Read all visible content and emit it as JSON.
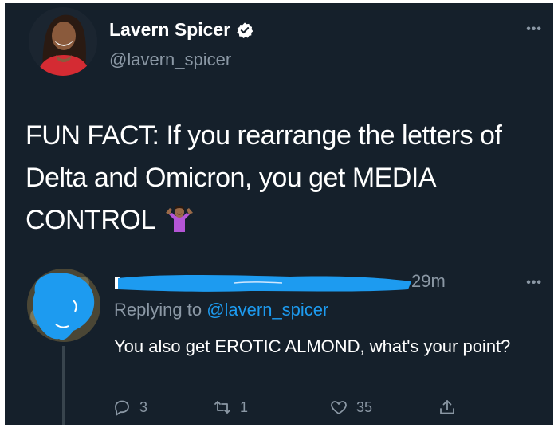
{
  "tweet": {
    "author_name": "Lavern Spicer",
    "author_handle": "@lavern_spicer",
    "text": "FUN FACT: If you rearrange the letters of Delta and Omicron, you get MEDIA CONTROL"
  },
  "reply": {
    "time": "29m",
    "replying_prefix": "Replying to ",
    "replying_to": "@lavern_spicer",
    "text": "You also get EROTIC ALMOND, what's your point?",
    "counts": {
      "replies": "3",
      "retweets": "1",
      "likes": "35"
    }
  },
  "icons": {
    "verified": "verified-badge-icon",
    "more": "more-horizontal-icon",
    "emoji": "person-shrugging-emoji",
    "reply": "reply-icon",
    "retweet": "retweet-icon",
    "like": "heart-icon",
    "share": "share-icon"
  },
  "colors": {
    "background": "#15202b",
    "primary_text": "#ffffff",
    "secondary_text": "#8b98a5",
    "link": "#1d9bf0",
    "redaction": "#1da1f2"
  }
}
